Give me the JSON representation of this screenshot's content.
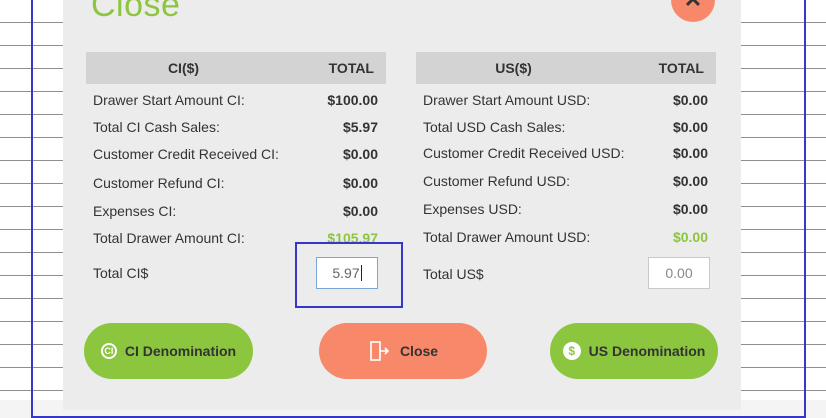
{
  "dialog": {
    "title": "Close",
    "close_icon": "close-icon"
  },
  "ci_table": {
    "headers": [
      "CI($)",
      "TOTAL"
    ],
    "rows": [
      {
        "label": "Drawer Start Amount CI:",
        "value": "$100.00"
      },
      {
        "label": "Total CI Cash Sales:",
        "value": "$5.97"
      },
      {
        "label": "Customer Credit Received CI:",
        "value": "$0.00"
      },
      {
        "label": "Customer Refund CI:",
        "value": "$0.00"
      },
      {
        "label": "Expenses CI:",
        "value": "$0.00"
      },
      {
        "label": "Total Drawer Amount CI:",
        "value": "$105.97"
      }
    ],
    "total_label": "Total CI$",
    "total_input_value": "5.97"
  },
  "us_table": {
    "headers": [
      "US($)",
      "TOTAL"
    ],
    "rows": [
      {
        "label": "Drawer Start Amount USD:",
        "value": "$0.00"
      },
      {
        "label": "Total USD Cash Sales:",
        "value": "$0.00"
      },
      {
        "label": "Customer Credit Received USD:",
        "value": "$0.00"
      },
      {
        "label": "Customer Refund USD:",
        "value": "$0.00"
      },
      {
        "label": "Expenses USD:",
        "value": "$0.00"
      },
      {
        "label": "Total Drawer Amount USD:",
        "value": "$0.00"
      }
    ],
    "total_label": "Total US$",
    "total_input_placeholder": "0.00"
  },
  "buttons": {
    "ci_denomination": "CI Denomination",
    "close": "Close",
    "us_denomination": "US Denomination"
  },
  "colors": {
    "accent_green": "#8cc63f",
    "accent_orange": "#f7896a",
    "focus_blue": "#3636c8"
  }
}
